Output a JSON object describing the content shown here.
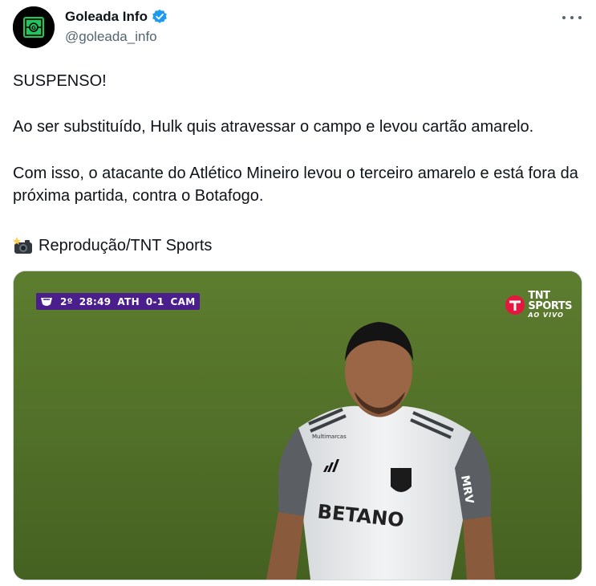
{
  "author": {
    "display_name": "Goleada Info",
    "handle": "@goleada_info",
    "verified": true,
    "avatar_icon": "green-pitch-logo"
  },
  "tweet": {
    "paragraphs": [
      "SUSPENSO!",
      "Ao ser substituído, Hulk quis atravessar o campo e levou cartão amarelo.",
      "Com isso, o atacante do Atlético Mineiro levou o terceiro amarelo e está fora da próxima partida, contra o Botafogo."
    ],
    "credit": "Reprodução/TNT Sports",
    "credit_icon": "camera-flash-emoji"
  },
  "media": {
    "scoreboard": {
      "period": "2º",
      "clock": "28:49",
      "home": "ATH",
      "score": "0-1",
      "away": "CAM"
    },
    "broadcaster": {
      "line1": "TNT",
      "line2": "SPORTS",
      "line3": "AO VIVO"
    },
    "shirt_sponsor": "BETANO",
    "shirt_sleeve": "MRV",
    "shirt_chest": "Multimarcas"
  },
  "colors": {
    "verified": "#1d9bf0",
    "text": "#0f1419",
    "secondary": "#536471",
    "scoreboard_bg": "#4a1f8c",
    "tnt_red": "#e4173e"
  }
}
